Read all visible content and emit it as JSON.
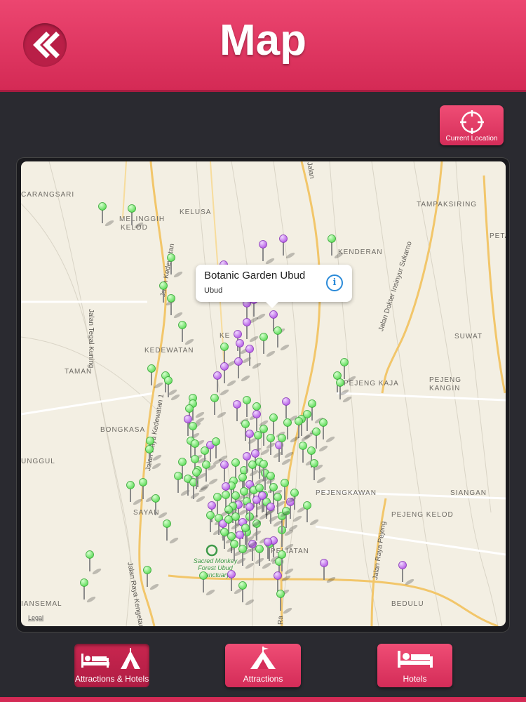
{
  "header": {
    "title": "Map",
    "back_icon": "double-chevron-left-icon"
  },
  "location_button": {
    "label": "Current Location",
    "icon": "crosshair-icon"
  },
  "map": {
    "callout": {
      "title": "Botanic Garden Ubud",
      "subtitle": "Ubud",
      "info_glyph": "i"
    },
    "legal": "Legal",
    "places": {
      "carangsari": "CARANGSARI",
      "melinggih": "MELINGGIH",
      "kelod": "KELOD",
      "kelusa": "KELUSA",
      "tampaksiring": "TAMPAKSIRING",
      "kenderan": "KENDERAN",
      "peta": "PETA",
      "suwat": "SUWAT",
      "kedewatan": "KEDEWATAN",
      "kel": "KE",
      "taman": "TAMAN",
      "pejeng_kaja": "PEJENG KAJA",
      "pejeng": "PEJENG",
      "kangin": "KANGIN",
      "bongkasa": "BONGKASA",
      "unggul": "UNGGUL",
      "pejengkawan": "PEJENGKAWAN",
      "siangan": "SIANGAN",
      "sayan": "SAYAN",
      "pejeng_kelod": "PEJENG KELOD",
      "peliatan": "PELIATAN",
      "iansemal": "IANSEMAL",
      "bedulu": "BEDULU",
      "monkey_forest": "Sacred Monkey Forest Ubud Sanctuary"
    },
    "roads": {
      "tegal_kuning": "Jalan Tegal Kuning",
      "sukarno": "Jalan Dokter Insinyur Sukarno",
      "raya_pejeng": "Jalan Raya Pejeng",
      "raya_kengetan": "Jalan Raya Kengetan",
      "kedewatan_road": "Jalan Raya Kedewatan 1",
      "top_road": "Jalan",
      "kedewatan_short": "Jalan Kedewatan",
      "bottom_road": "Ra"
    },
    "pin_colors": {
      "hotel": "#5fdc5a",
      "attraction": "#b65ee6"
    }
  },
  "tabs": [
    {
      "label": "Attractions & Hotels",
      "icon": "bed-and-tent-icon",
      "active": true
    },
    {
      "label": "Attractions",
      "icon": "tent-icon",
      "active": false
    },
    {
      "label": "Hotels",
      "icon": "bed-icon",
      "active": false
    }
  ]
}
